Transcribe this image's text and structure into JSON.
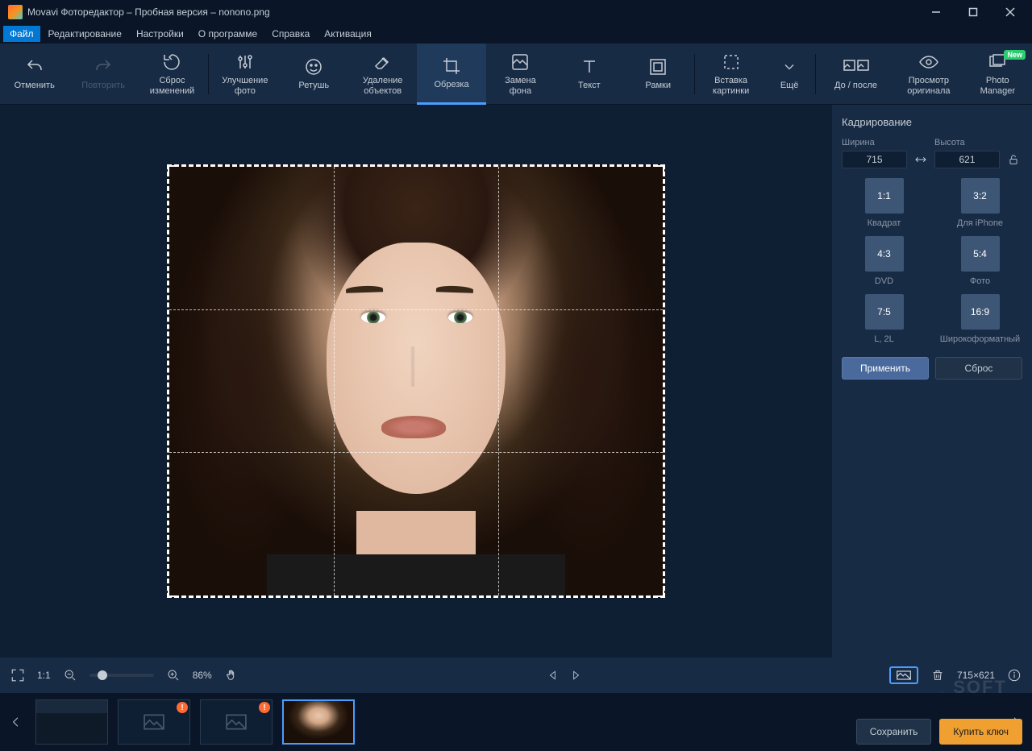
{
  "titlebar": {
    "title": "Movavi Фоторедактор – Пробная версия – nonono.png"
  },
  "menubar": {
    "file": "Файл",
    "edit": "Редактирование",
    "settings": "Настройки",
    "about": "О программе",
    "help": "Справка",
    "activation": "Активация"
  },
  "toolbar": {
    "undo": "Отменить",
    "redo": "Повторить",
    "reset": "Сброс\nизменений",
    "enhance": "Улучшение\nфото",
    "retouch": "Ретушь",
    "remove": "Удаление\nобъектов",
    "crop": "Обрезка",
    "replace_bg": "Замена\nфона",
    "text": "Текст",
    "frames": "Рамки",
    "insert": "Вставка\nкартинки",
    "more": "Ещё",
    "before_after": "До / после",
    "view_original": "Просмотр\nоригинала",
    "photo_manager": "Photo\nManager",
    "new_badge": "New"
  },
  "panel": {
    "title": "Кадрирование",
    "width_label": "Ширина",
    "width_value": "715",
    "height_label": "Высота",
    "height_value": "621",
    "ratios": [
      {
        "ratio": "1:1",
        "label": "Квадрат"
      },
      {
        "ratio": "3:2",
        "label": "Для iPhone"
      },
      {
        "ratio": "4:3",
        "label": "DVD"
      },
      {
        "ratio": "5:4",
        "label": "Фото"
      },
      {
        "ratio": "7:5",
        "label": "L, 2L"
      },
      {
        "ratio": "16:9",
        "label": "Широкоформатный"
      }
    ],
    "apply": "Применить",
    "reset": "Сброс"
  },
  "statusbar": {
    "one_to_one": "1:1",
    "zoom": "86%",
    "dimensions": "715×621"
  },
  "footer": {
    "save": "Сохранить",
    "buy": "Купить ключ"
  },
  "watermark": "SOFT\nSALAD"
}
